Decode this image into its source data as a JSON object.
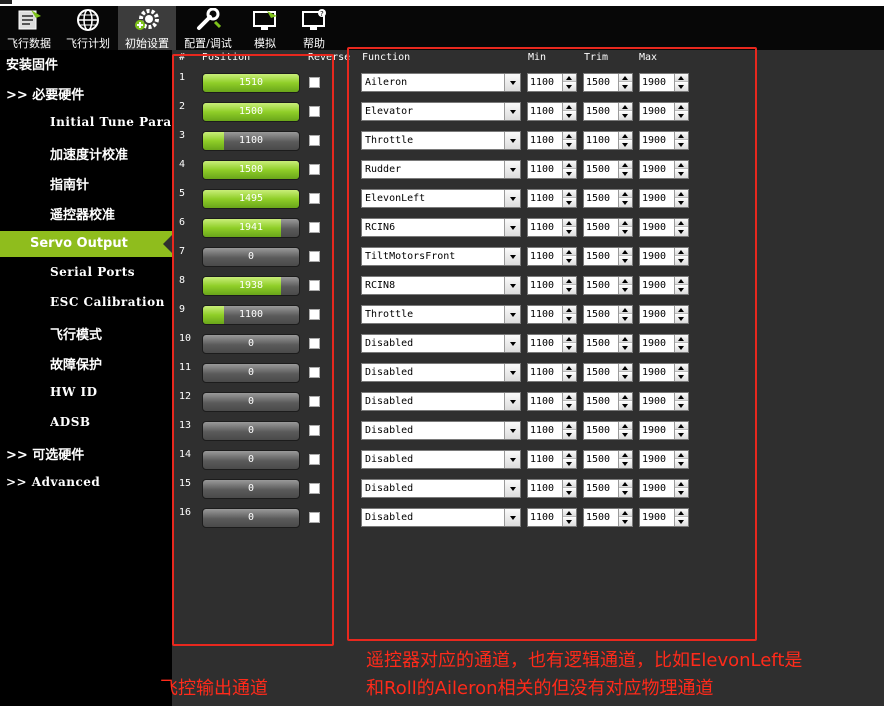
{
  "toolbar": {
    "items": [
      {
        "label": "飞行数据",
        "icon": "flight-data-icon"
      },
      {
        "label": "飞行计划",
        "icon": "flight-plan-globe-icon"
      },
      {
        "label": "初始设置",
        "icon": "initial-setup-gear-icon",
        "active": true
      },
      {
        "label": "配置/调试",
        "icon": "config-tuning-wrench-icon"
      },
      {
        "label": "模拟",
        "icon": "simulation-monitor-icon"
      },
      {
        "label": "帮助",
        "icon": "help-monitor-icon"
      }
    ]
  },
  "sidebar": {
    "items": [
      {
        "label": "安装固件"
      },
      {
        "label": ">> 必要硬件"
      },
      {
        "label": "Initial Tune Parameters"
      },
      {
        "label": "加速度计校准"
      },
      {
        "label": "指南针"
      },
      {
        "label": "遥控器校准"
      },
      {
        "label": "Servo Output",
        "selected": true
      },
      {
        "label": "Serial Ports"
      },
      {
        "label": "ESC Calibration"
      },
      {
        "label": "飞行模式"
      },
      {
        "label": "故障保护"
      },
      {
        "label": "HW ID"
      },
      {
        "label": "ADSB"
      },
      {
        "label": ">> 可选硬件"
      },
      {
        "label": ">> Advanced"
      }
    ]
  },
  "servo_table": {
    "headers": {
      "num": "#",
      "position": "Position",
      "reverse": "Reverse",
      "function": "Function",
      "min": "Min",
      "trim": "Trim",
      "max": "Max"
    },
    "rows": [
      {
        "num": "1",
        "position": "1510",
        "fill": 1.0,
        "reverse": false,
        "function": "Aileron",
        "min": "1100",
        "trim": "1500",
        "max": "1900"
      },
      {
        "num": "2",
        "position": "1500",
        "fill": 1.0,
        "reverse": false,
        "function": "Elevator",
        "min": "1100",
        "trim": "1500",
        "max": "1900"
      },
      {
        "num": "3",
        "position": "1100",
        "fill": 0.22,
        "reverse": false,
        "function": "Throttle",
        "min": "1100",
        "trim": "1100",
        "max": "1900"
      },
      {
        "num": "4",
        "position": "1500",
        "fill": 1.0,
        "reverse": false,
        "function": "Rudder",
        "min": "1100",
        "trim": "1500",
        "max": "1900"
      },
      {
        "num": "5",
        "position": "1495",
        "fill": 1.0,
        "reverse": false,
        "function": "ElevonLeft",
        "min": "1100",
        "trim": "1500",
        "max": "1900"
      },
      {
        "num": "6",
        "position": "1941",
        "fill": 0.81,
        "reverse": false,
        "function": "RCIN6",
        "min": "1100",
        "trim": "1500",
        "max": "1900"
      },
      {
        "num": "7",
        "position": "0",
        "fill": 0,
        "reverse": false,
        "function": "TiltMotorsFront",
        "min": "1100",
        "trim": "1500",
        "max": "1900"
      },
      {
        "num": "8",
        "position": "1938",
        "fill": 0.81,
        "reverse": false,
        "function": "RCIN8",
        "min": "1100",
        "trim": "1500",
        "max": "1900"
      },
      {
        "num": "9",
        "position": "1100",
        "fill": 0.22,
        "reverse": false,
        "function": "Throttle",
        "min": "1100",
        "trim": "1500",
        "max": "1900"
      },
      {
        "num": "10",
        "position": "0",
        "fill": 0,
        "reverse": false,
        "function": "Disabled",
        "min": "1100",
        "trim": "1500",
        "max": "1900"
      },
      {
        "num": "11",
        "position": "0",
        "fill": 0,
        "reverse": false,
        "function": "Disabled",
        "min": "1100",
        "trim": "1500",
        "max": "1900"
      },
      {
        "num": "12",
        "position": "0",
        "fill": 0,
        "reverse": false,
        "function": "Disabled",
        "min": "1100",
        "trim": "1500",
        "max": "1900"
      },
      {
        "num": "13",
        "position": "0",
        "fill": 0,
        "reverse": false,
        "function": "Disabled",
        "min": "1100",
        "trim": "1500",
        "max": "1900"
      },
      {
        "num": "14",
        "position": "0",
        "fill": 0,
        "reverse": false,
        "function": "Disabled",
        "min": "1100",
        "trim": "1500",
        "max": "1900"
      },
      {
        "num": "15",
        "position": "0",
        "fill": 0,
        "reverse": false,
        "function": "Disabled",
        "min": "1100",
        "trim": "1500",
        "max": "1900"
      },
      {
        "num": "16",
        "position": "0",
        "fill": 0,
        "reverse": false,
        "function": "Disabled",
        "min": "1100",
        "trim": "1500",
        "max": "1900"
      }
    ]
  },
  "annotations": {
    "left_caption": "飞控输出通道",
    "right_caption_line1": "遥控器对应的通道，也有逻辑通道，比如ElevonLeft是",
    "right_caption_line2": "和Roll的Aileron相关的但没有对应物理通道",
    "color": "#e8281e"
  },
  "colors": {
    "accent_green": "#8fbd1d",
    "panel_bg": "#2f2f2f",
    "sidebar_bg": "#000000"
  }
}
